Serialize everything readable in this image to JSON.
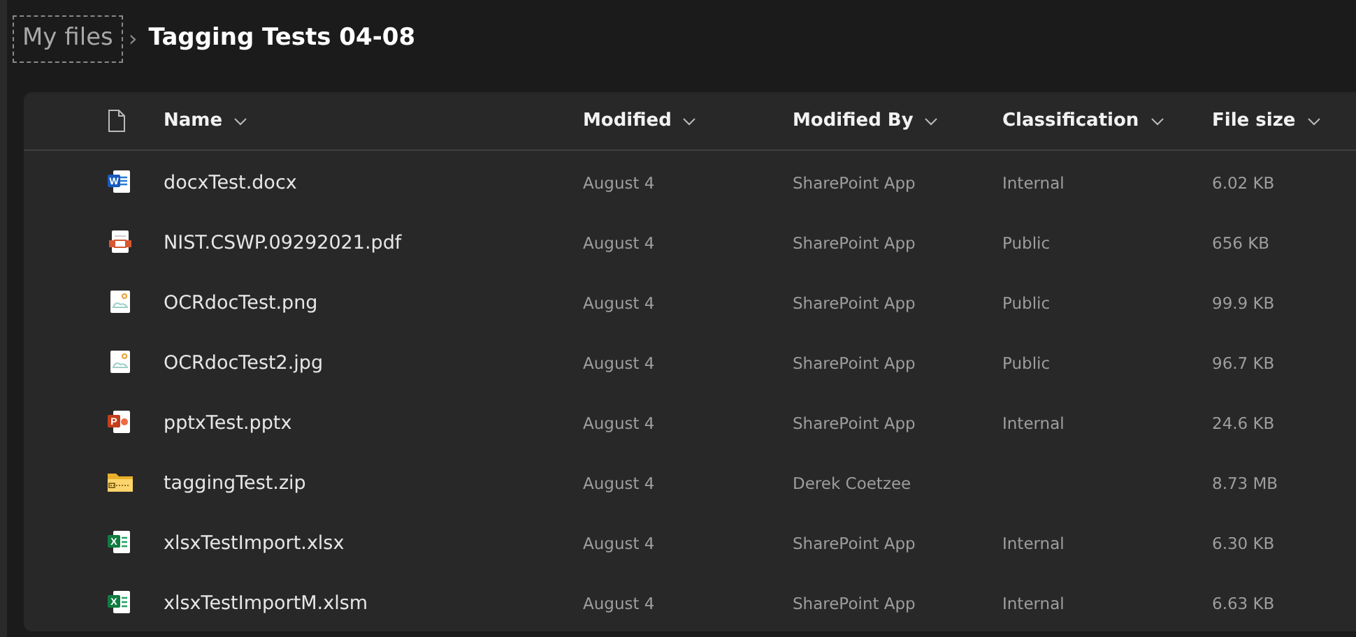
{
  "breadcrumb": {
    "parent": "My files",
    "separator": "›",
    "current": "Tagging Tests 04-08"
  },
  "columns": [
    "Name",
    "Modified",
    "Modified By",
    "Classification",
    "File size"
  ],
  "rows": [
    {
      "kind": "word",
      "icon_letter": "W",
      "name": "docxTest.docx",
      "modified": "August 4",
      "modified_by": "SharePoint App",
      "classification": "Internal",
      "size": "6.02 KB"
    },
    {
      "kind": "pdf",
      "name": "NIST.CSWP.09292021.pdf",
      "modified": "August 4",
      "modified_by": "SharePoint App",
      "classification": "Public",
      "size": "656 KB"
    },
    {
      "kind": "image",
      "name": "OCRdocTest.png",
      "modified": "August 4",
      "modified_by": "SharePoint App",
      "classification": "Public",
      "size": "99.9 KB"
    },
    {
      "kind": "image",
      "name": "OCRdocTest2.jpg",
      "modified": "August 4",
      "modified_by": "SharePoint App",
      "classification": "Public",
      "size": "96.7 KB"
    },
    {
      "kind": "powerpoint",
      "icon_letter": "P",
      "name": "pptxTest.pptx",
      "modified": "August 4",
      "modified_by": "SharePoint App",
      "classification": "Internal",
      "size": "24.6 KB"
    },
    {
      "kind": "zip",
      "name": "taggingTest.zip",
      "modified": "August 4",
      "modified_by": "Derek Coetzee",
      "size": "8.73 MB"
    },
    {
      "kind": "excel",
      "icon_letter": "X",
      "name": "xlsxTestImport.xlsx",
      "modified": "August 4",
      "modified_by": "SharePoint App",
      "classification": "Internal",
      "size": "6.30 KB"
    },
    {
      "kind": "excel",
      "icon_letter": "X",
      "name": "xlsxTestImportM.xlsm",
      "modified": "August 4",
      "modified_by": "SharePoint App",
      "classification": "Internal",
      "size": "6.63 KB"
    }
  ]
}
